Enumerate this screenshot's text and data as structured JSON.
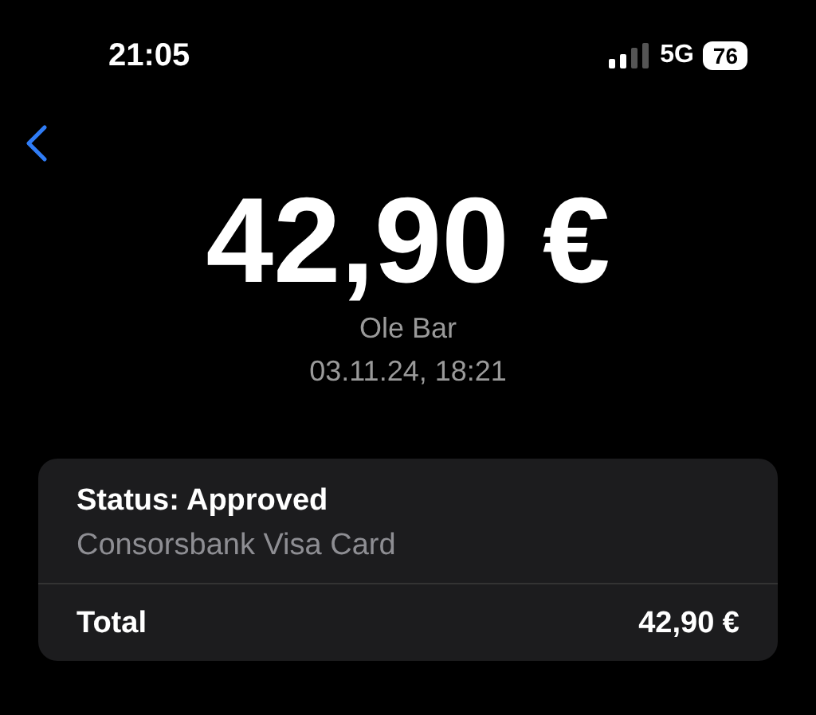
{
  "status_bar": {
    "time": "21:05",
    "network": "5G",
    "battery": "76"
  },
  "amount": "42,90 €",
  "merchant": "Ole Bar",
  "datetime": "03.11.24, 18:21",
  "card": {
    "status": "Status: Approved",
    "payment_method": "Consorsbank Visa Card",
    "total_label": "Total",
    "total_value": "42,90 €"
  }
}
